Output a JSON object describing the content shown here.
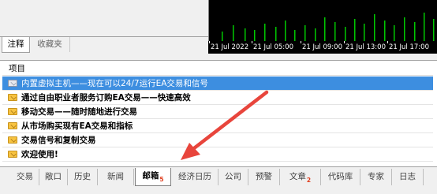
{
  "nav_tabs": [
    {
      "label": "注释",
      "active": true
    },
    {
      "label": "收藏夹",
      "active": false
    }
  ],
  "chart": {
    "background": "#000000",
    "bar_color": "#00c800",
    "time_labels": [
      "21 Jul 2022",
      "21 Jul 05:00",
      "21 Jul 09:00",
      "21 Jul 13:00",
      "21 Jul 17:00"
    ]
  },
  "mailbox": {
    "column_header": "项目",
    "messages": [
      {
        "subject": "内置虚拟主机——现在可以24/7运行EA交易和信号",
        "selected": true,
        "read": true
      },
      {
        "subject": "通过自由职业者服务订购EA交易——快速高效",
        "selected": false,
        "read": false
      },
      {
        "subject": "移动交易——随时随地进行交易",
        "selected": false,
        "read": false
      },
      {
        "subject": "从市场购买现有EA交易和指标",
        "selected": false,
        "read": false
      },
      {
        "subject": "交易信号和复制交易",
        "selected": false,
        "read": false
      },
      {
        "subject": "欢迎使用!",
        "selected": false,
        "read": false
      }
    ]
  },
  "bottom_tabs": {
    "trade": "交易",
    "exposure": "敞口",
    "history": "历史",
    "news": "新闻",
    "mailbox": "邮箱",
    "mailbox_badge": "5",
    "calendar": "经济日历",
    "company": "公司",
    "alerts": "预警",
    "articles": "文章",
    "articles_badge": "2",
    "codebase": "代码库",
    "experts": "专家",
    "journal": "日志"
  },
  "annotation": {
    "arrow_color": "#e8453c"
  }
}
